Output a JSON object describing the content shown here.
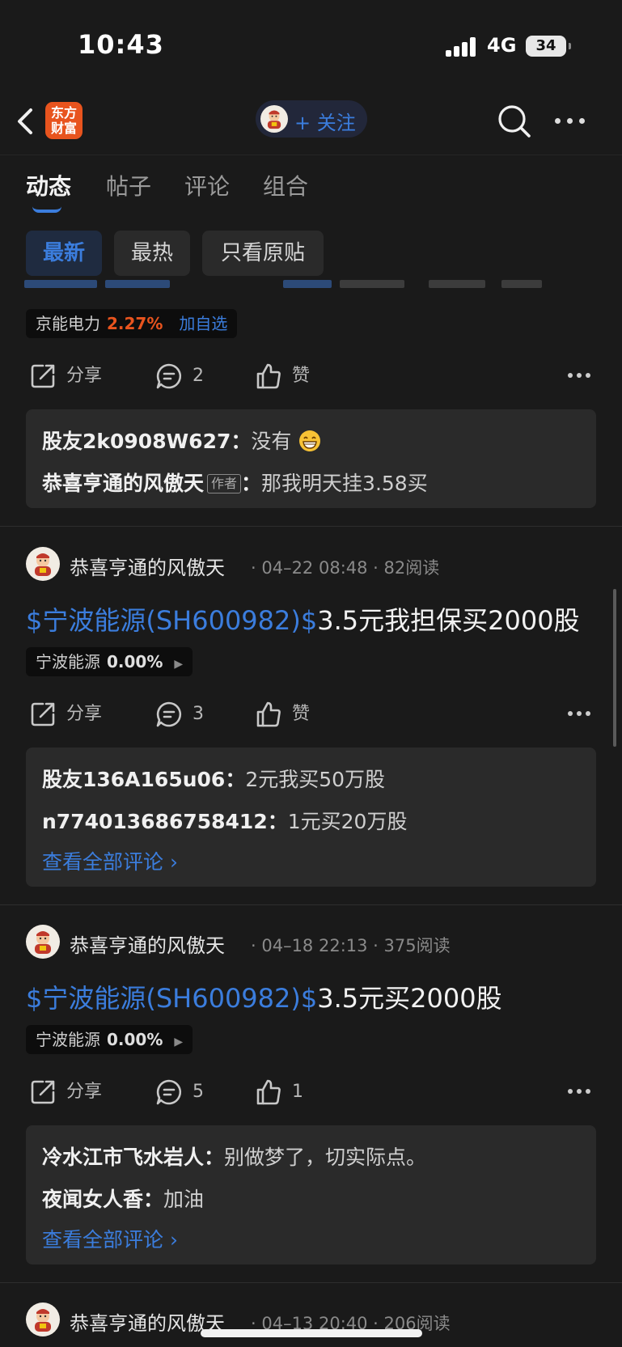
{
  "status_bar": {
    "time": "10:43",
    "network": "4G",
    "battery": "34"
  },
  "header": {
    "logo_text_line1": "东方",
    "logo_text_line2": "财富",
    "follow_label": "+ 关注"
  },
  "tabs": [
    {
      "label": "动态",
      "active": true
    },
    {
      "label": "帖子",
      "active": false
    },
    {
      "label": "评论",
      "active": false
    },
    {
      "label": "组合",
      "active": false
    }
  ],
  "filters": [
    {
      "label": "最新",
      "active": true
    },
    {
      "label": "最热",
      "active": false
    },
    {
      "label": "只看原贴",
      "active": false
    }
  ],
  "colors": {
    "accent": "#3b7ddd",
    "up": "#e8541e",
    "background": "#1a1a1a",
    "card": "#2a2a2a"
  },
  "posts": [
    {
      "partial": true,
      "stock": {
        "name": "京能电力",
        "change": "2.27%",
        "add": "加自选"
      },
      "actions": {
        "share": "分享",
        "comments": "2",
        "like": "赞"
      },
      "comments": [
        {
          "user": "股友2k0908W627",
          "sep": "：",
          "text": "没有",
          "emoji": "grin-emoji"
        },
        {
          "user": "恭喜亨通的风傲天",
          "author_tag": "作者",
          "sep": "：",
          "text": "那我明天挂3.58买"
        }
      ]
    },
    {
      "author": "恭喜亨通的风傲天",
      "date": "· 04–22 08:48 · 82阅读",
      "title_link": "$宁波能源(SH600982)$",
      "title_text": "3.5元我担保买2000股",
      "stock": {
        "name": "宁波能源",
        "change": "0.00%",
        "arrow": "▶"
      },
      "actions": {
        "share": "分享",
        "comments": "3",
        "like": "赞"
      },
      "comments": [
        {
          "user": "股友136A165u06",
          "sep": "：",
          "text": "2元我买50万股"
        },
        {
          "user": "n774013686758412",
          "sep": "：",
          "text": "1元买20万股"
        }
      ],
      "view_all": "查看全部评论 ›"
    },
    {
      "author": "恭喜亨通的风傲天",
      "date": "· 04–18 22:13 · 375阅读",
      "title_link": "$宁波能源(SH600982)$",
      "title_text": "3.5元买2000股",
      "stock": {
        "name": "宁波能源",
        "change": "0.00%",
        "arrow": "▶"
      },
      "actions": {
        "share": "分享",
        "comments": "5",
        "like": "1"
      },
      "comments": [
        {
          "user": "冷水江市飞水岩人",
          "sep": "：",
          "text": "别做梦了，切实际点。"
        },
        {
          "user": "夜闻女人香",
          "sep": "：",
          "text": "加油"
        }
      ],
      "view_all": "查看全部评论 ›"
    },
    {
      "author": "恭喜亨通的风傲天",
      "date": "· 04–13 20:40 · 206阅读",
      "partial": true
    }
  ]
}
